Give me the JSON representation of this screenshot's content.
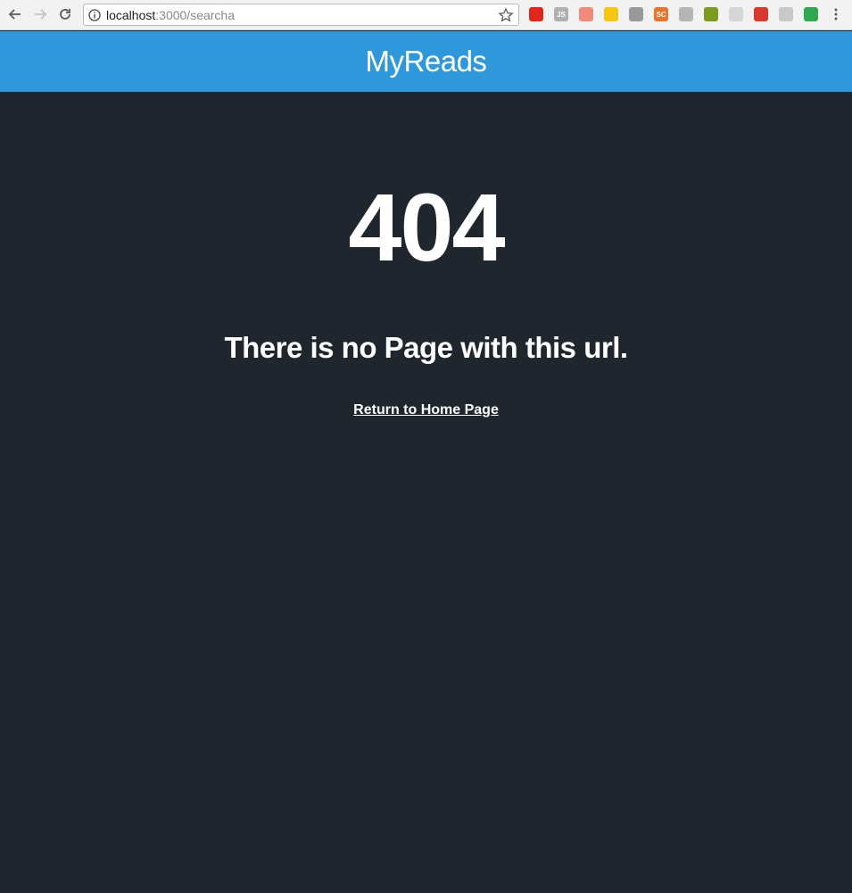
{
  "browser": {
    "url_host": "localhost",
    "url_path": ":3000/searcha",
    "extensions": [
      {
        "name": "opera-icon",
        "color": "#e0261d"
      },
      {
        "name": "js-icon",
        "color": "#b0b0b0",
        "label": "JS"
      },
      {
        "name": "arrow-ext-icon",
        "color": "#f08a7a"
      },
      {
        "name": "magnifier-ext-icon",
        "color": "#f4c60f"
      },
      {
        "name": "gray-circle-icon",
        "color": "#9a9a9a"
      },
      {
        "name": "sc-icon",
        "color": "#e8742c",
        "label": "SC"
      },
      {
        "name": "gray-square-icon",
        "color": "#b5b5b5"
      },
      {
        "name": "monitor-icon",
        "color": "#7a9c1e"
      },
      {
        "name": "circle-outline-icon",
        "color": "#d6d6d6"
      },
      {
        "name": "red-ext-icon",
        "color": "#d9382f"
      },
      {
        "name": "brackets-ext-icon",
        "color": "#c8c8c8"
      },
      {
        "name": "check-ext-icon",
        "color": "#2fa84f"
      }
    ]
  },
  "header": {
    "title": "MyReads",
    "background": "#2e98db"
  },
  "main": {
    "background": "#1f262e",
    "error_code": "404",
    "message": "There is no Page with this url.",
    "home_link": "Return to Home Page"
  }
}
